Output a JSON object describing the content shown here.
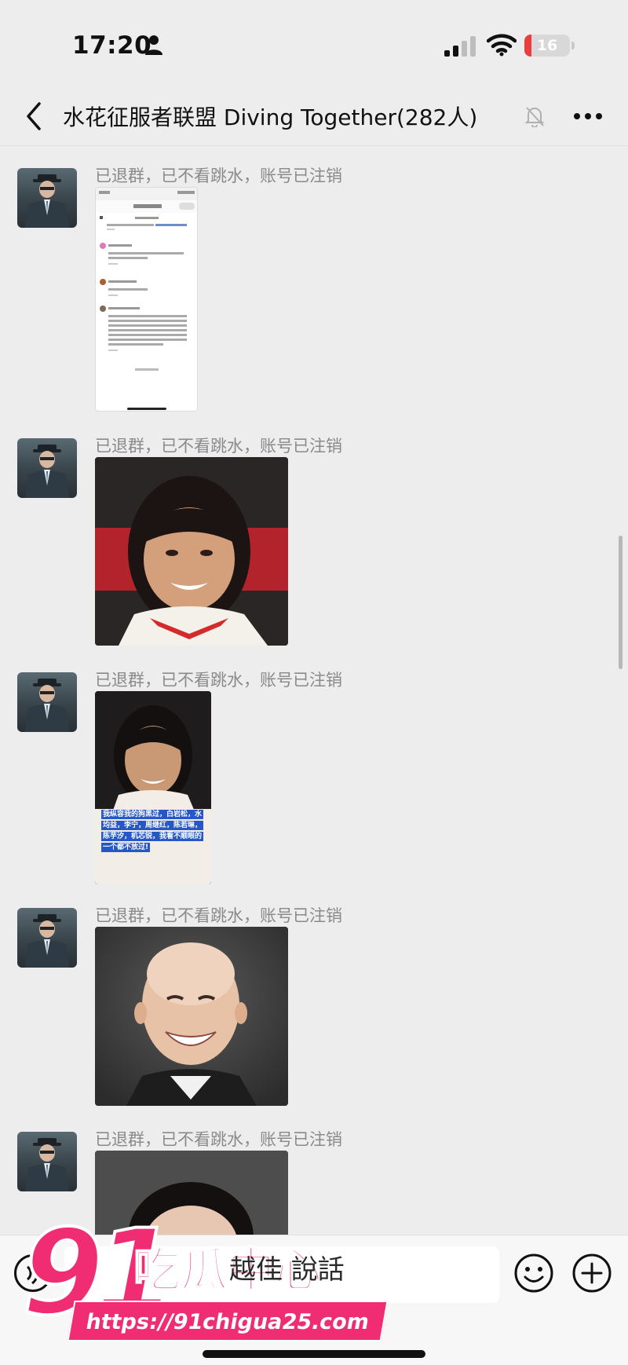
{
  "status_bar": {
    "time": "17:20",
    "battery_level": "16",
    "battery_fraction": 0.16
  },
  "header": {
    "back_icon": "chevron-left-icon",
    "title": "水花征服者联盟 Diving Together(282人)",
    "mute_icon": "bell-slash-icon",
    "more_icon": "ellipsis-icon"
  },
  "messages": [
    {
      "sender": "已退群，已不看跳水，账号已注销",
      "content": "screenshot-image"
    },
    {
      "sender": "已退群，已不看跳水，账号已注销",
      "content": "photo-image"
    },
    {
      "sender": "已退群，已不看跳水，账号已注销",
      "content": "photo-image"
    },
    {
      "sender": "已退群，已不看跳水，账号已注销",
      "content": "photo-image"
    },
    {
      "sender": "已退群，已不看跳水，账号已注销",
      "content": "photo-image"
    }
  ],
  "meme_caption": "我纵容我的狗黑过，白岩松，水均益，李宁，周继红，陈若琳，陈芋汐，机芯锐，我看不顺眼的一个都不放过!",
  "input_bar": {
    "placeholder": "",
    "voice_icon": "voice-icon",
    "emoji_icon": "emoji-icon",
    "plus_icon": "plus-icon"
  },
  "watermark": {
    "number": "91",
    "brand": "吃瓜中心",
    "overlay": "越佳 說話",
    "url": "https://91chigua25.com"
  }
}
